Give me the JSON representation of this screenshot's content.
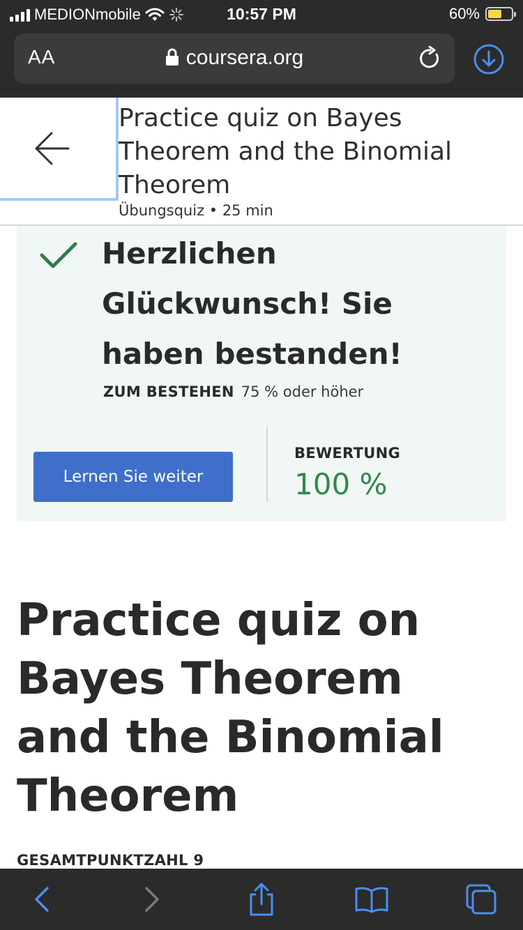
{
  "status_bar": {
    "carrier": "MEDIONmobile",
    "time": "10:57 PM",
    "battery_percent": "60%",
    "battery_level": 0.6,
    "battery_color": "#f6d94b"
  },
  "browser": {
    "text_size_label": "AA",
    "url": "coursera.org",
    "icons": [
      "lock-icon",
      "reload-icon",
      "download-icon"
    ]
  },
  "header": {
    "title": "Practice quiz on Bayes Theorem and the Binomial Theorem",
    "meta": "Übungsquiz • 25 min"
  },
  "result": {
    "heading": "Herzlichen Glückwunsch! Sie haben bestanden!",
    "pass_label": "ZUM BESTEHEN",
    "pass_value": "75 % oder höher",
    "continue_button": "Lernen Sie weiter",
    "grade_label": "BEWERTUNG",
    "grade_value": "100 %",
    "accent_color": "#2e8a4a",
    "button_color": "#3f6fca"
  },
  "main": {
    "title": "Practice quiz on Bayes Theorem and the Binomial Theorem",
    "total_points": "GESAMTPUNKTZAHL 9"
  },
  "toolbar": {
    "items": [
      "back-icon",
      "forward-icon",
      "share-icon",
      "bookmarks-icon",
      "tabs-icon"
    ]
  }
}
